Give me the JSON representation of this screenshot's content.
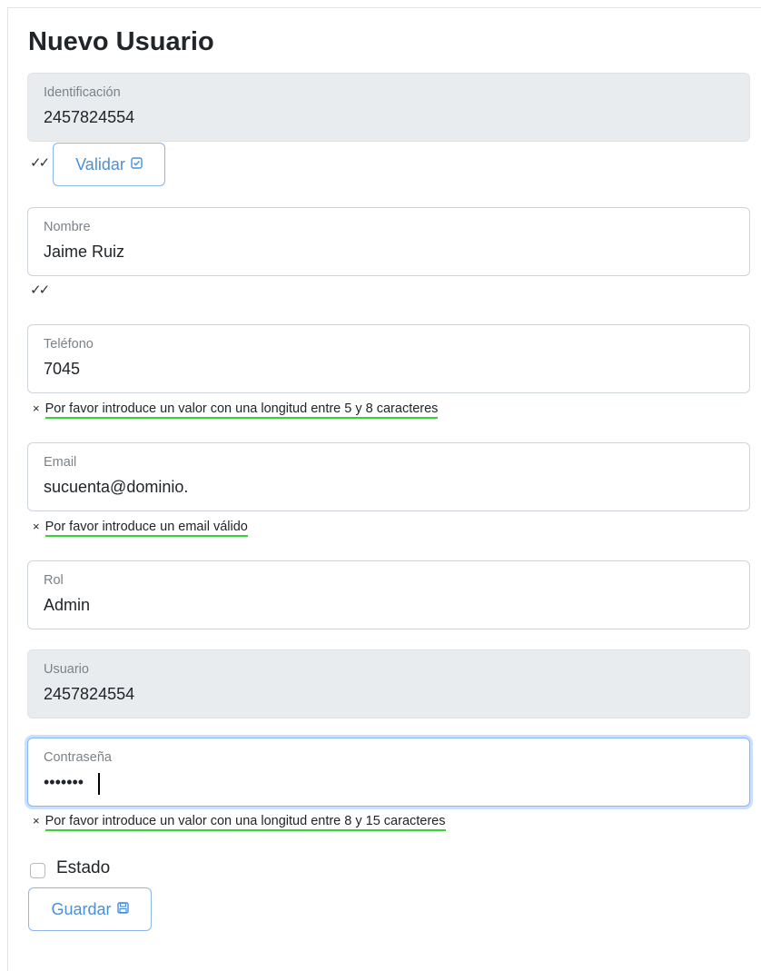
{
  "form": {
    "title": "Nuevo Usuario",
    "identificacion": {
      "label": "Identificación",
      "value": "2457824554"
    },
    "validar_label": "Validar",
    "nombre": {
      "label": "Nombre",
      "value": "Jaime Ruiz"
    },
    "telefono": {
      "label": "Teléfono",
      "value": "7045",
      "error": "Por favor introduce un valor con una longitud entre 5 y 8 caracteres"
    },
    "email": {
      "label": "Email",
      "value": "sucuenta@dominio.",
      "error": "Por favor introduce un email válido"
    },
    "rol": {
      "label": "Rol",
      "value": "Admin"
    },
    "usuario": {
      "label": "Usuario",
      "value": "2457824554"
    },
    "contrasena": {
      "label": "Contraseña",
      "value": "•••••••",
      "error": "Por favor introduce un valor con una longitud entre 8 y 15 caracteres"
    },
    "estado_label": "Estado",
    "guardar_label": "Guardar",
    "valid_mark": "✓✓",
    "error_mark": "×"
  },
  "icons": {
    "validar": "check-square-icon",
    "guardar": "save-icon"
  },
  "colors": {
    "button_text": "#4a90d9",
    "button_border": "#8bb5ec",
    "error_underline": "#33d433",
    "disabled_bg": "#e9ecef",
    "focus_border": "#86b7fe"
  }
}
